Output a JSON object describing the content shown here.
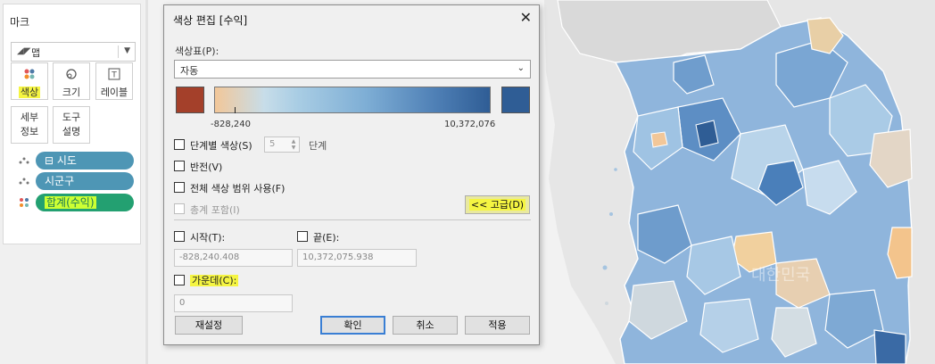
{
  "marks": {
    "title": "마크",
    "mark_type": "맵",
    "buttons": {
      "color": "색상",
      "size": "크기",
      "label": "레이블",
      "detail_line1": "세부",
      "detail_line2": "정보",
      "tooltip_line1": "도구",
      "tooltip_line2": "설명"
    },
    "pills": [
      {
        "label": "⊟ 시도"
      },
      {
        "label": "시군구"
      },
      {
        "label": "합계(수익)"
      }
    ]
  },
  "dialog": {
    "title": "색상 편집 [수익]",
    "close": "✕",
    "palette_label": "색상표(P):",
    "palette_value": "자동",
    "min_value": "-828,240",
    "max_value": "10,372,076",
    "stepped_label": "단계별 색상(S)",
    "steps_value": "5",
    "steps_unit": "단계",
    "reversed_label": "반전(V)",
    "full_range_label": "전체 색상 범위 사용(F)",
    "include_totals_label": "총계 포함(I)",
    "advanced_button": "<< 고급(D)",
    "start_label": "시작(T):",
    "end_label": "끝(E):",
    "start_value": "-828,240.408",
    "end_value": "10,372,075.938",
    "center_label": "가운데(C):",
    "center_value": "0",
    "reset_button": "재설정",
    "ok_button": "확인",
    "cancel_button": "취소",
    "apply_button": "적용"
  },
  "map": {
    "watermark": "대한민국"
  },
  "colors": {
    "pill_blue": "#4e96b5",
    "pill_green": "#23a071",
    "highlight": "#f5f542",
    "palette_start": "#a4402a",
    "palette_end": "#2f5d95"
  }
}
